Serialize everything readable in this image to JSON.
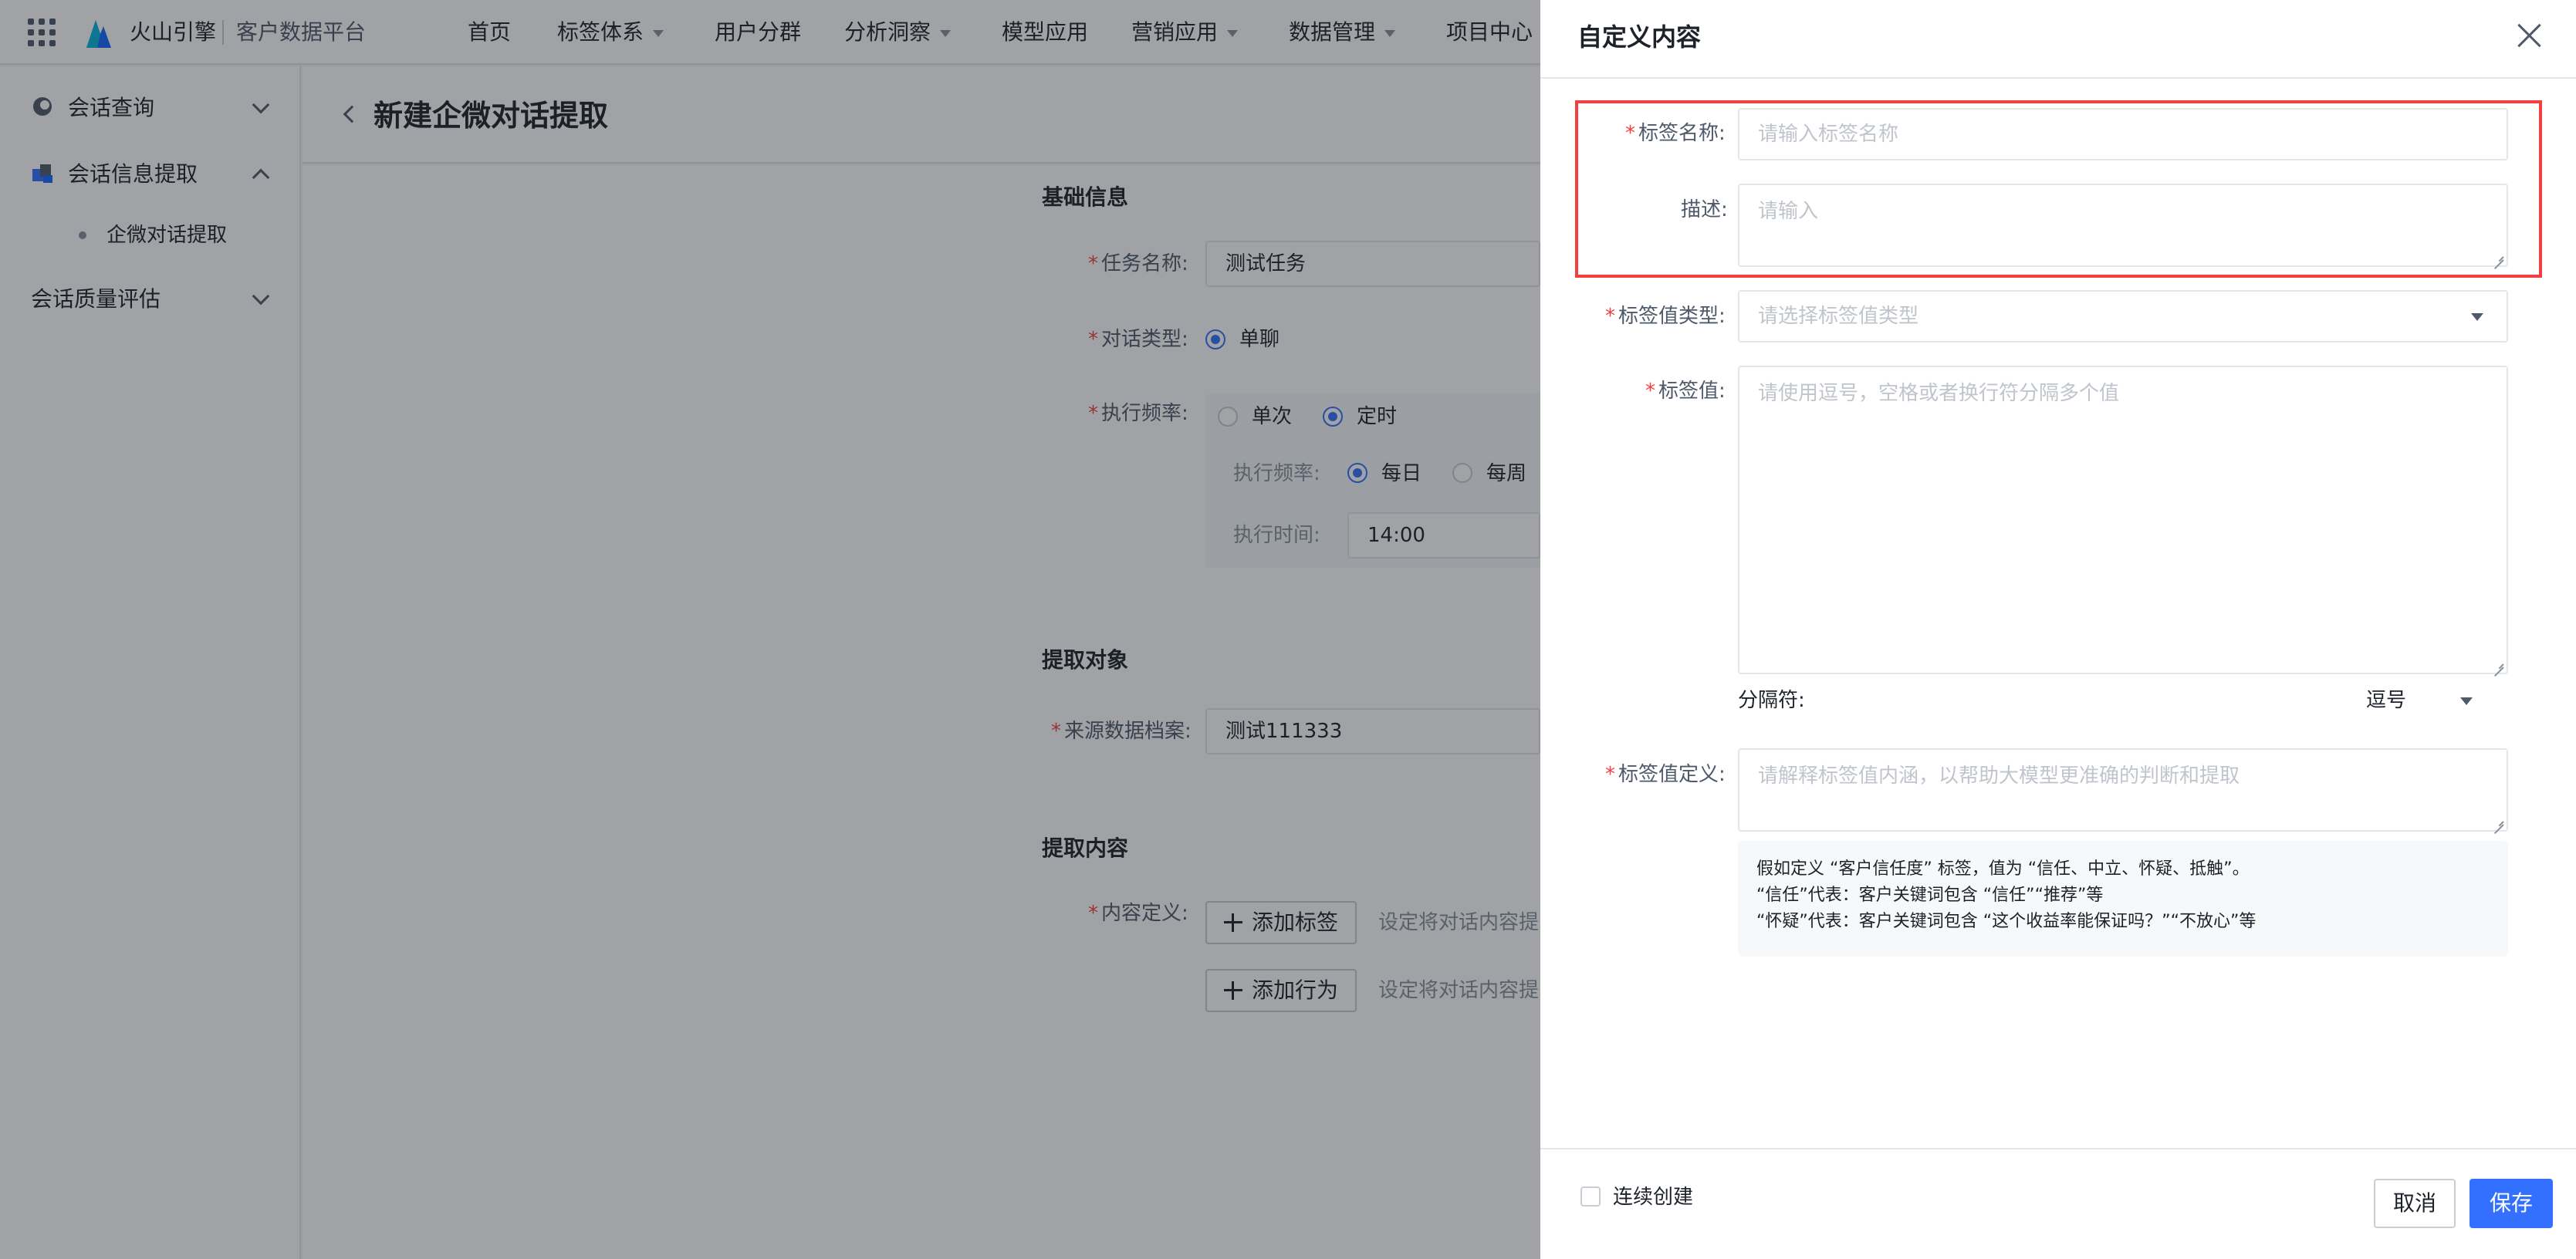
{
  "topbar": {
    "brand": "火山引擎",
    "product": "客户数据平台",
    "nav": [
      {
        "label": "首页",
        "dropdown": false
      },
      {
        "label": "标签体系",
        "dropdown": true
      },
      {
        "label": "用户分群",
        "dropdown": false
      },
      {
        "label": "分析洞察",
        "dropdown": true
      },
      {
        "label": "模型应用",
        "dropdown": false
      },
      {
        "label": "营销应用",
        "dropdown": true
      },
      {
        "label": "数据管理",
        "dropdown": true
      },
      {
        "label": "项目中心",
        "dropdown": false
      }
    ]
  },
  "sidebar": {
    "items": [
      {
        "label": "会话查询",
        "icon": "chat-search-icon",
        "expanded": false
      },
      {
        "label": "会话信息提取",
        "icon": "extract-icon",
        "expanded": true,
        "children": [
          {
            "label": "企微对话提取"
          }
        ]
      },
      {
        "label": "会话质量评估",
        "expanded": false
      }
    ]
  },
  "page": {
    "title": "新建企微对话提取",
    "sections": {
      "basic": "基础信息",
      "target": "提取对象",
      "content": "提取内容"
    },
    "fields": {
      "task_name_label": "任务名称:",
      "task_name_value": "测试任务",
      "dialog_type_label": "对话类型:",
      "dialog_type_option": "单聊",
      "exec_freq_label": "执行频率:",
      "exec_once": "单次",
      "exec_timed": "定时",
      "sub_freq_label": "执行频率:",
      "daily": "每日",
      "weekly": "每周",
      "exec_time_label": "执行时间:",
      "exec_time_value": "14:00",
      "source_label": "来源数据档案:",
      "source_value": "测试111333",
      "content_def_label": "内容定义:",
      "add_tag": "添加标签",
      "add_action": "添加行为",
      "hint": "设定将对话内容提"
    }
  },
  "drawer": {
    "title": "自定义内容",
    "tag_name_label": "标签名称:",
    "tag_name_placeholder": "请输入标签名称",
    "desc_label": "描述:",
    "desc_placeholder": "请输入",
    "value_type_label": "标签值类型:",
    "value_type_placeholder": "请选择标签值类型",
    "value_label": "标签值:",
    "value_placeholder": "请使用逗号，空格或者换行符分隔多个值",
    "separator_label": "分隔符:",
    "separator_value": "逗号",
    "definition_label": "标签值定义:",
    "definition_placeholder": "请解释标签值内涵，以帮助大模型更准确的判断和提取",
    "example_lines": [
      "假如定义 “客户信任度” 标签，值为 “信任、中立、怀疑、抵触”。",
      "“信任”代表：客户关键词包含 “信任”“推荐”等",
      "“怀疑”代表：客户关键词包含 “这个收益率能保证吗？”“不放心”等"
    ],
    "continuous_create": "连续创建",
    "cancel": "取消",
    "save": "保存"
  },
  "colors": {
    "primary": "#3370ff",
    "required": "#f53f3f",
    "highlight_box": "#f53f3f"
  }
}
